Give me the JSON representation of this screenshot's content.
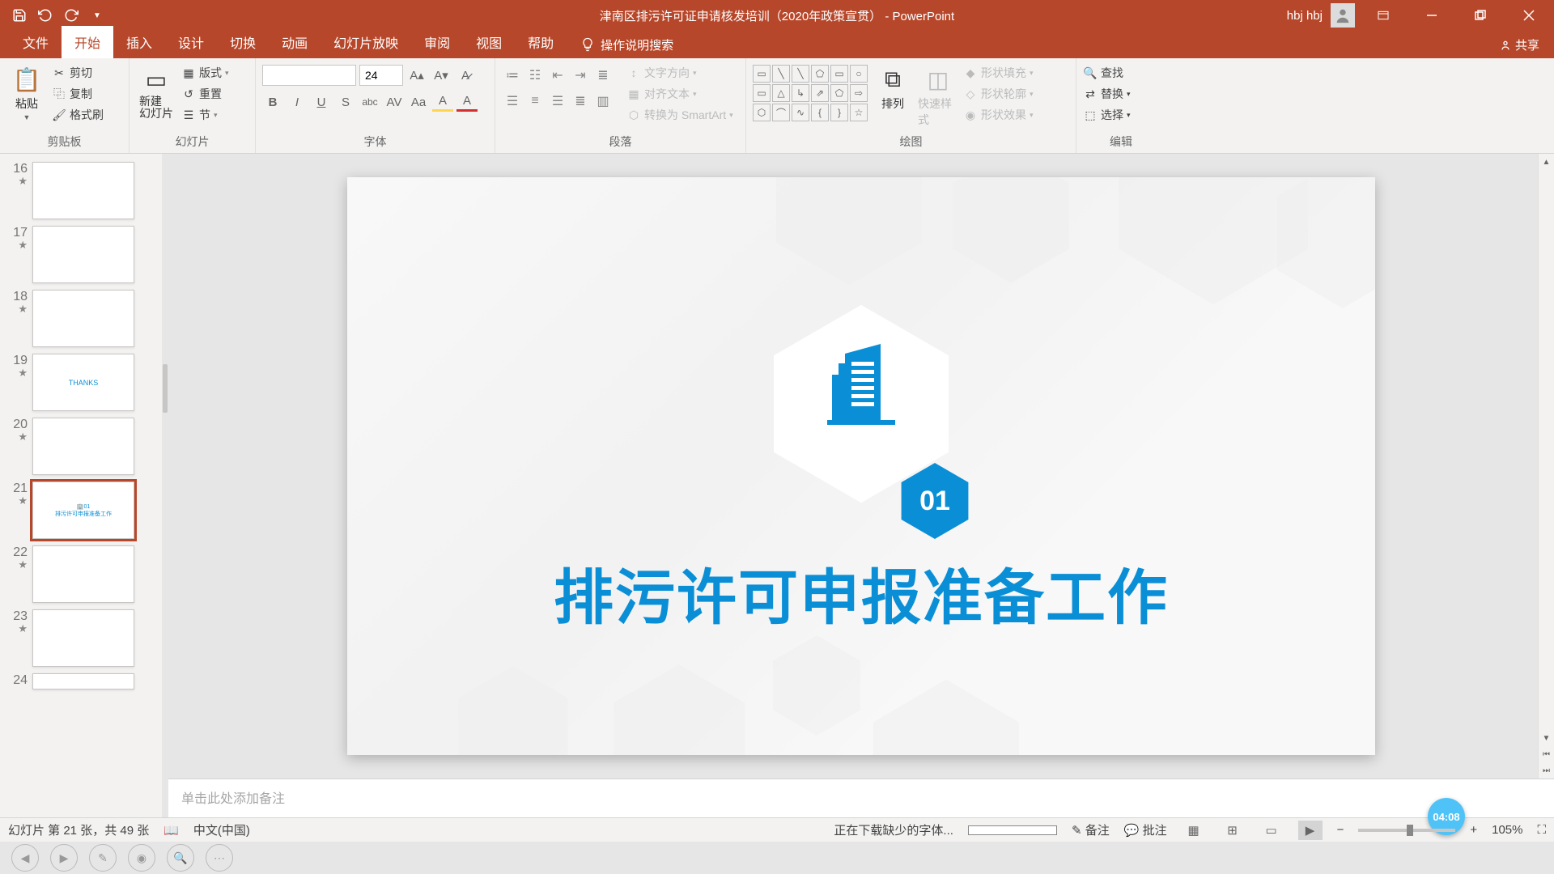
{
  "app": {
    "title": "津南区排污许可证申请核发培训（2020年政策宣贯） - PowerPoint"
  },
  "user": {
    "name": "hbj hbj"
  },
  "menu": {
    "tabs": [
      "文件",
      "开始",
      "插入",
      "设计",
      "切换",
      "动画",
      "幻灯片放映",
      "审阅",
      "视图",
      "帮助"
    ],
    "tellme": "操作说明搜索",
    "share": "共享"
  },
  "ribbon": {
    "clipboard": {
      "paste": "粘贴",
      "cut": "剪切",
      "copy": "复制",
      "painter": "格式刷",
      "label": "剪贴板"
    },
    "slides": {
      "new": "新建\n幻灯片",
      "layout": "版式",
      "reset": "重置",
      "section": "节",
      "label": "幻灯片"
    },
    "font": {
      "size": "24",
      "label": "字体"
    },
    "paragraph": {
      "textdir": "文字方向",
      "align": "对齐文本",
      "smartart": "转换为 SmartArt",
      "label": "段落"
    },
    "drawing": {
      "arrange": "排列",
      "quickstyle": "快速样式",
      "fill": "形状填充",
      "outline": "形状轮廓",
      "effects": "形状效果",
      "label": "绘图"
    },
    "editing": {
      "find": "查找",
      "replace": "替换",
      "select": "选择",
      "label": "编辑"
    }
  },
  "thumbnails": [
    {
      "num": "16"
    },
    {
      "num": "17"
    },
    {
      "num": "18"
    },
    {
      "num": "19"
    },
    {
      "num": "20"
    },
    {
      "num": "21"
    },
    {
      "num": "22"
    },
    {
      "num": "23"
    },
    {
      "num": "24"
    }
  ],
  "slide": {
    "badge": "01",
    "title": "排污许可申报准备工作"
  },
  "notes": {
    "placeholder": "单击此处添加备注"
  },
  "status": {
    "slideinfo": "幻灯片 第 21 张，共 49 张",
    "language": "中文(中国)",
    "fontdl": "正在下载缺少的字体...",
    "notesbtn": "备注",
    "commentsbtn": "批注",
    "zoom": "105%"
  },
  "timestamp": "04:08"
}
